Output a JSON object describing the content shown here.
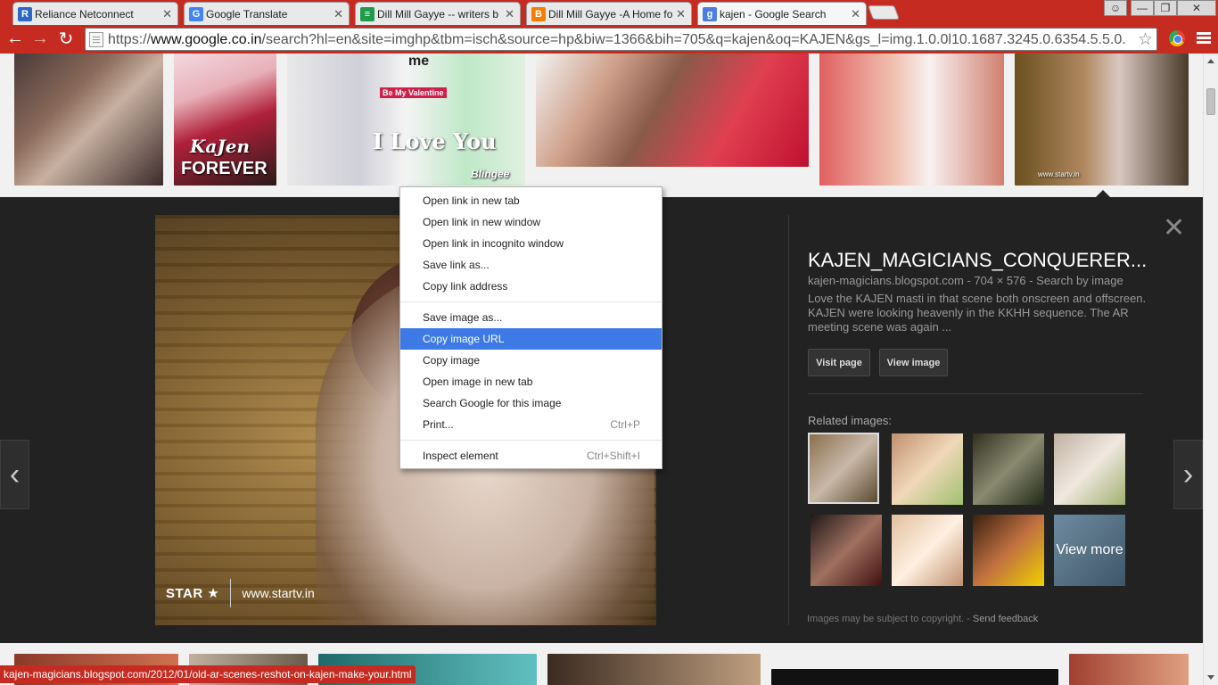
{
  "tabs": [
    {
      "title": "Reliance Netconnect",
      "favicon": "R",
      "favicon_color": "#2c68c8"
    },
    {
      "title": "Google Translate",
      "favicon": "G",
      "favicon_color": "#4285f4"
    },
    {
      "title": "Dill Mill Gayye -- writers b",
      "favicon": "≡",
      "favicon_color": "#1e9b4b"
    },
    {
      "title": "Dill Mill Gayye -A Home fo",
      "favicon": "B",
      "favicon_color": "#f57d00"
    },
    {
      "title": "kajen - Google Search",
      "favicon": "g",
      "favicon_color": "#4a7fe0",
      "active": true
    }
  ],
  "toolbar": {
    "url_prefix": "https://",
    "url_host": "www.google.co.in",
    "url_rest": "/search?hl=en&site=imghp&tbm=isch&source=hp&biw=1366&bih=705&q=kajen&oq=KAJEN&gs_l=img.1.0.0l10.1687.3245.0.6354.5.5.0."
  },
  "thumbs": {
    "t2_caption_top": "KaJen",
    "t2_caption_bottom": "FOREVER",
    "t3_badge": "Be My Valentine",
    "t3_caption": "I Love You",
    "t3_top": "me",
    "t3_brand": "Blingee",
    "t6_watermark": "www.startv.in"
  },
  "preview": {
    "brand": "STAR",
    "site": "www.startv.in"
  },
  "info": {
    "title": "KAJEN_MAGICIANS_CONQUERER...",
    "meta": "kajen-magicians.blogspot.com - 704 × 576 - Search by image",
    "description": "Love the KAJEN masti in that scene both onscreen and offscreen. KAJEN were looking heavenly in the KKHH sequence. The AR meeting scene was again ...",
    "visit_page": "Visit page",
    "view_image": "View image",
    "related_label": "Related images:",
    "view_more": "View more",
    "copyright": "Images may be subject to copyright.",
    "feedback": "Send feedback"
  },
  "context_menu": {
    "items": [
      {
        "label": "Open link in new tab"
      },
      {
        "label": "Open link in new window"
      },
      {
        "label": "Open link in incognito window"
      },
      {
        "label": "Save link as..."
      },
      {
        "label": "Copy link address"
      },
      {
        "label": "Save image as..."
      },
      {
        "label": "Copy image URL",
        "highlighted": true
      },
      {
        "label": "Copy image"
      },
      {
        "label": "Open image in new tab"
      },
      {
        "label": "Search Google for this image"
      },
      {
        "label": "Print...",
        "shortcut": "Ctrl+P"
      },
      {
        "label": "Inspect element",
        "shortcut": "Ctrl+Shift+I"
      }
    ]
  },
  "status_bar": {
    "text": "kajen-magicians.blogspot.com/2012/01/old-ar-scenes-reshot-on-kajen-make-your.html"
  },
  "colors": {
    "chrome_accent": "#c62b22",
    "menu_highlight": "#3e7ae6",
    "panel_bg": "#222222"
  }
}
